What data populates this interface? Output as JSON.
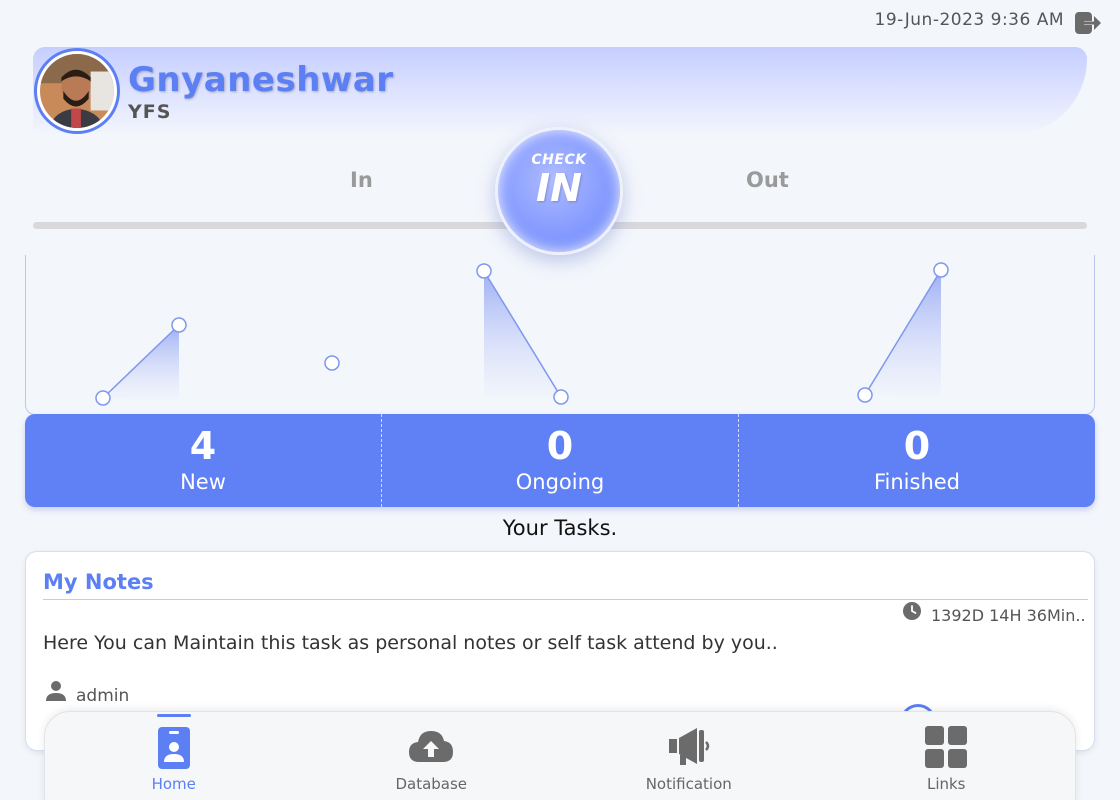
{
  "header": {
    "datetime": "19-Jun-2023 9:36 AM"
  },
  "profile": {
    "name": "Gnyaneshwar",
    "org": "YFS"
  },
  "attendance": {
    "in_label": "In",
    "out_label": "Out",
    "button_top": "CHECK",
    "button_main": "IN"
  },
  "stats": [
    {
      "count": "4",
      "label": "New"
    },
    {
      "count": "0",
      "label": "Ongoing"
    },
    {
      "count": "0",
      "label": "Finished"
    }
  ],
  "tasks_title": "Your Tasks.",
  "note": {
    "title": "My Notes",
    "duration": "1392D 14H 36Min..",
    "body": "Here You can Maintain this task as personal notes or self task attend by you..",
    "author": "admin"
  },
  "nav": {
    "items": [
      {
        "label": "Home",
        "icon": "id-badge-icon",
        "active": true
      },
      {
        "label": "Database",
        "icon": "cloud-upload-icon",
        "active": false
      },
      {
        "label": "Notification",
        "icon": "megaphone-icon",
        "active": false
      },
      {
        "label": "Links",
        "icon": "grid-icon",
        "active": false
      }
    ]
  },
  "colors": {
    "accent": "#5c7ff4",
    "stats_bg": "#6081f5",
    "muted": "#9a9a9a"
  }
}
